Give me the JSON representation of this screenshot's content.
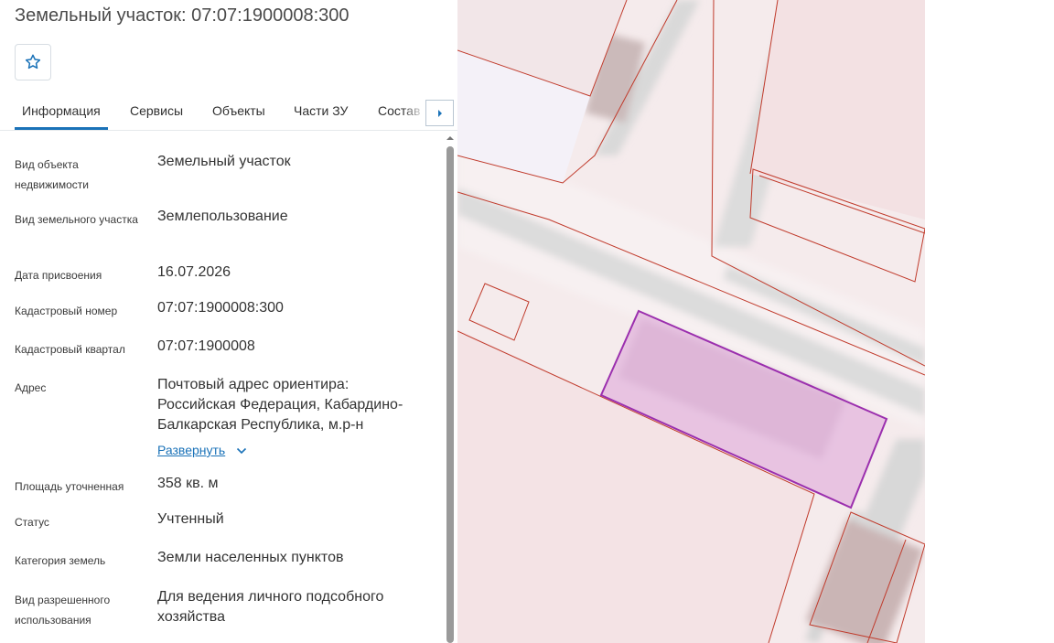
{
  "header": {
    "title": "Земельный участок: 07:07:1900008:300"
  },
  "favorite": {
    "icon": "star-outline-icon",
    "accent": "#1a72b8"
  },
  "tabs": [
    {
      "label": "Информация",
      "active": true
    },
    {
      "label": "Сервисы"
    },
    {
      "label": "Объекты"
    },
    {
      "label": "Части ЗУ"
    },
    {
      "label": "Состав"
    }
  ],
  "tabs_next_icon": "chevron-right-icon",
  "info": [
    {
      "label": "Вид объекта недвижимости",
      "value": "Земельный участок"
    },
    {
      "label": "Вид земельного участка",
      "value": "Землепользование"
    },
    {
      "label": "Дата присвоения",
      "value": "16.07.2026"
    },
    {
      "label": "Кадастровый номер",
      "value": "07:07:1900008:300"
    },
    {
      "label": "Кадастровый квартал",
      "value": "07:07:1900008"
    },
    {
      "label": "Адрес",
      "value": "Почтовый адрес ориентира: Российская Федерация, Кабардино-Балкарская Республика, м.р-н",
      "expand_label": "Развернуть"
    },
    {
      "label": "Площадь уточненная",
      "value": "358 кв. м"
    },
    {
      "label": "Статус",
      "value": "Учтенный"
    },
    {
      "label": "Категория земель",
      "value": "Земли населенных пунктов"
    },
    {
      "label": "Вид разрешенного использования",
      "value": "Для ведения личного подсобного хозяйства"
    }
  ],
  "map": {
    "parcel_outline_color": "#c03a2b",
    "selected_parcel_color": "#9b2fae",
    "selected_fill_color": "#e3b6de"
  }
}
